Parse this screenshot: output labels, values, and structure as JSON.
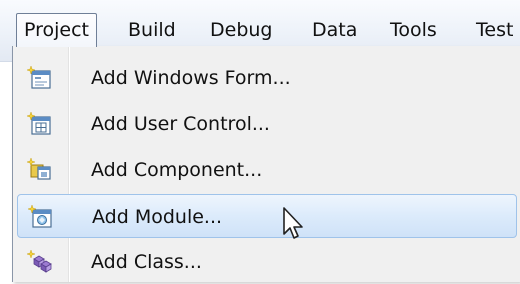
{
  "menubar": {
    "items": [
      {
        "label": "Project"
      },
      {
        "label": "Build"
      },
      {
        "label": "Debug"
      },
      {
        "label": "Data"
      },
      {
        "label": "Tools"
      },
      {
        "label": "Test"
      }
    ]
  },
  "project_menu": {
    "items": [
      {
        "label": "Add Windows Form...",
        "icon": "windows-form-icon"
      },
      {
        "label": "Add User Control...",
        "icon": "user-control-icon"
      },
      {
        "label": "Add Component...",
        "icon": "component-icon"
      },
      {
        "label": "Add Module...",
        "icon": "module-icon",
        "highlighted": true
      },
      {
        "label": "Add Class...",
        "icon": "class-icon"
      }
    ]
  },
  "colors": {
    "hover_fill": "#dcebfb",
    "hover_border": "#9fc3ea",
    "menu_background": "#f0f0f0",
    "menubar_background": "#edf2f9"
  }
}
